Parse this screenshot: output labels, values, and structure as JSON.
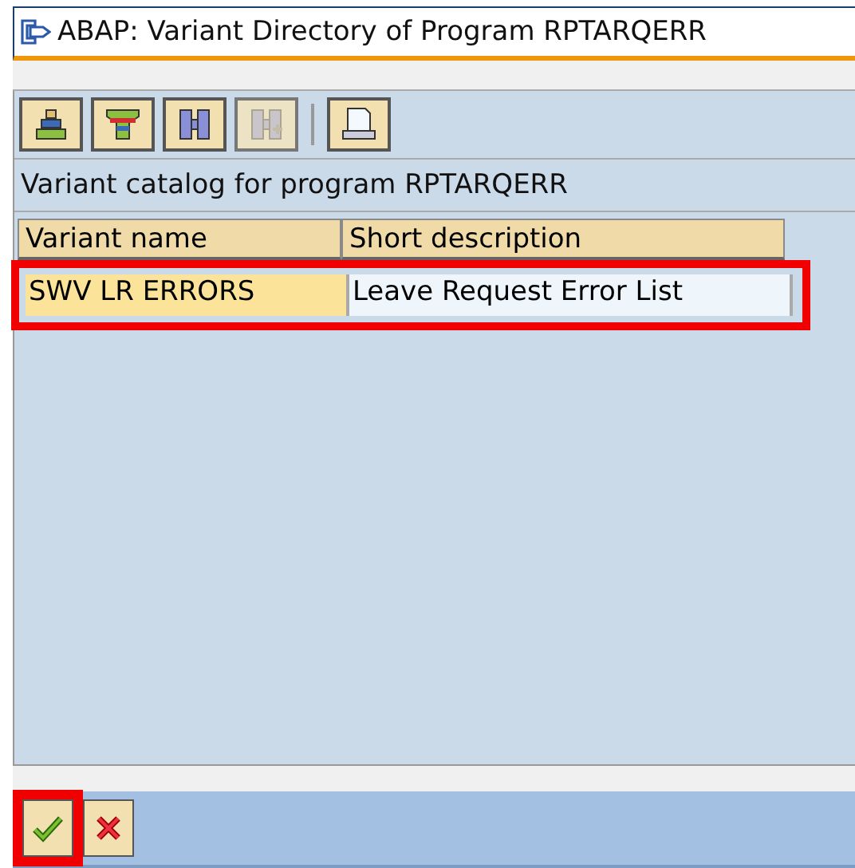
{
  "window": {
    "title": "ABAP: Variant Directory of Program RPTARQERR"
  },
  "toolbar": [
    {
      "kind": "sort",
      "disabled": false
    },
    {
      "kind": "filter",
      "disabled": false
    },
    {
      "kind": "find",
      "disabled": false
    },
    {
      "kind": "find-next",
      "disabled": true
    },
    {
      "kind": "separator"
    },
    {
      "kind": "print",
      "disabled": false
    }
  ],
  "caption": "Variant catalog for program RPTARQERR",
  "table": {
    "columns": [
      "Variant name",
      "Short description"
    ],
    "rows": [
      {
        "cells": [
          "SWV LR ERRORS",
          "Leave Request Error List"
        ],
        "highlighted": true
      }
    ]
  },
  "footer_buttons": [
    {
      "kind": "confirm",
      "highlighted": true
    },
    {
      "kind": "cancel",
      "highlighted": false
    }
  ]
}
